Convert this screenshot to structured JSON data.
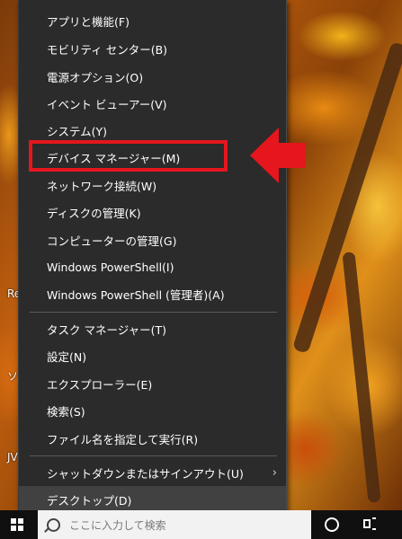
{
  "desktop": {
    "icon_labels": [
      "Re",
      "ソ",
      "JV"
    ]
  },
  "menu": {
    "groups": [
      [
        {
          "label": "アプリと機能(F)"
        },
        {
          "label": "モビリティ センター(B)"
        },
        {
          "label": "電源オプション(O)"
        },
        {
          "label": "イベント ビューアー(V)"
        },
        {
          "label": "システム(Y)"
        },
        {
          "label": "デバイス マネージャー(M)"
        },
        {
          "label": "ネットワーク接続(W)"
        },
        {
          "label": "ディスクの管理(K)"
        },
        {
          "label": "コンピューターの管理(G)"
        },
        {
          "label": "Windows PowerShell(I)"
        },
        {
          "label": "Windows PowerShell (管理者)(A)"
        }
      ],
      [
        {
          "label": "タスク マネージャー(T)"
        },
        {
          "label": "設定(N)"
        },
        {
          "label": "エクスプローラー(E)"
        },
        {
          "label": "検索(S)"
        },
        {
          "label": "ファイル名を指定して実行(R)"
        }
      ],
      [
        {
          "label": "シャットダウンまたはサインアウト(U)",
          "submenu": true
        },
        {
          "label": "デスクトップ(D)",
          "hovered": true
        }
      ]
    ],
    "highlighted_item": "デバイス マネージャー(M)",
    "annotation_color": "#e5161d"
  },
  "taskbar": {
    "search_placeholder": "ここに入力して検索",
    "icons": [
      "windows-start-icon",
      "search-icon",
      "cortana-icon",
      "task-view-icon"
    ]
  }
}
